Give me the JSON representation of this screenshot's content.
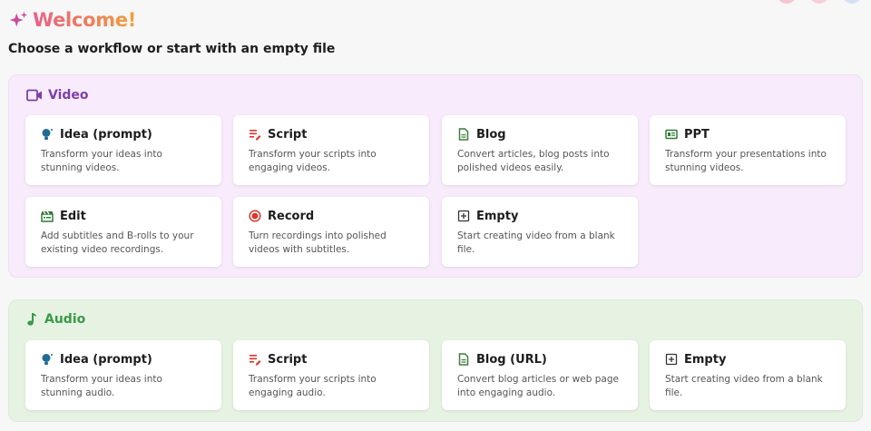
{
  "header": {
    "welcome": "Welcome!"
  },
  "subtitle": "Choose a workflow or start with an empty file",
  "colors": {
    "video_accent": "#7b3fa6",
    "audio_accent": "#3a9a46",
    "welcome_gradient": [
      "#e8608a",
      "#f0a33a"
    ]
  },
  "video": {
    "title": "Video",
    "cards": [
      {
        "title": "Idea (prompt)",
        "desc": "Transform your ideas into stunning videos.",
        "icon": "lightbulb-icon"
      },
      {
        "title": "Script",
        "desc": "Transform your scripts into engaging videos.",
        "icon": "script-icon"
      },
      {
        "title": "Blog",
        "desc": "Convert articles, blog posts into polished videos easily.",
        "icon": "document-icon"
      },
      {
        "title": "PPT",
        "desc": "Transform your presentations into stunning videos.",
        "icon": "presentation-icon"
      },
      {
        "title": "Edit",
        "desc": "Add subtitles and B-rolls to your existing video recordings.",
        "icon": "clapperboard-icon"
      },
      {
        "title": "Record",
        "desc": "Turn recordings into polished videos with subtitles.",
        "icon": "record-icon"
      },
      {
        "title": "Empty",
        "desc": "Start creating video from a blank file.",
        "icon": "plus-square-icon"
      }
    ]
  },
  "audio": {
    "title": "Audio",
    "cards": [
      {
        "title": "Idea (prompt)",
        "desc": "Transform your ideas into stunning audio.",
        "icon": "lightbulb-icon"
      },
      {
        "title": "Script",
        "desc": "Transform your scripts into engaging audio.",
        "icon": "script-icon"
      },
      {
        "title": "Blog (URL)",
        "desc": "Convert blog articles or web page into engaging audio.",
        "icon": "document-icon"
      },
      {
        "title": "Empty",
        "desc": "Start creating video from a blank file.",
        "icon": "plus-square-icon"
      }
    ]
  }
}
